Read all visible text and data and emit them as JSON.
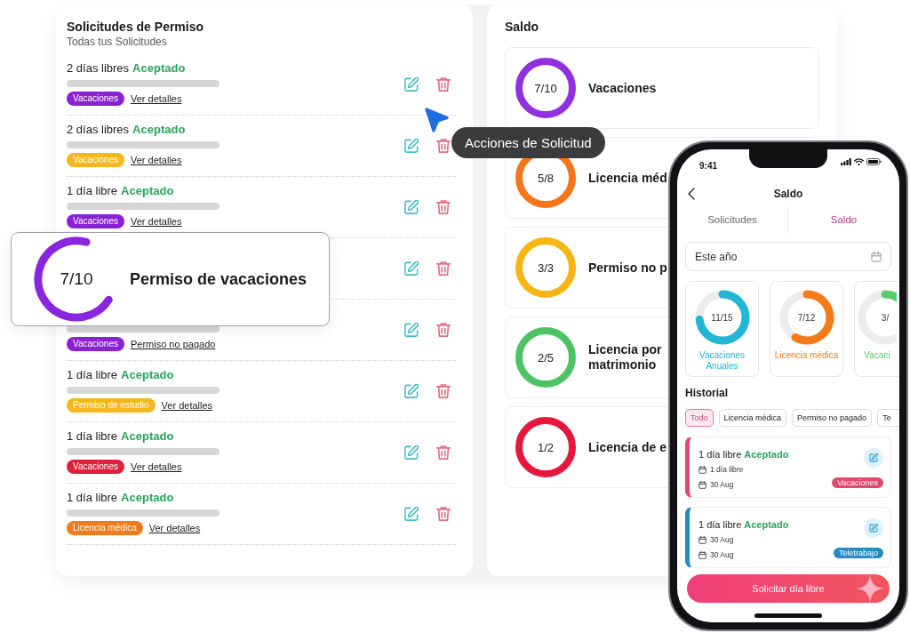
{
  "requests_panel": {
    "title": "Solicitudes de Permiso",
    "subtitle": "Todas tus Solicitudes",
    "rows": [
      {
        "title": "2 días libres",
        "status": "Aceptado",
        "tag": "Vacaciones",
        "color": "#8a22d2",
        "link": "Ver detalles"
      },
      {
        "title": "2 días libres",
        "status": "Aceptado",
        "tag": "Vacaciones",
        "color": "#f4b71c",
        "link": "Ver detalles"
      },
      {
        "title": "1 día libre",
        "status": "Aceptado",
        "tag": "Vacaciones",
        "color": "#8a22d2",
        "link": "Ver detalles"
      },
      {},
      {
        "tag": "Vacaciones",
        "color": "#8a22d2",
        "link": "Permiso no pagado"
      },
      {
        "title": "1 día libre",
        "status": "Aceptado",
        "tag": "Permiso de estudio",
        "color": "#f4b71c",
        "link": "Ver detalles"
      },
      {
        "title": "1 día libre",
        "status": "Aceptado",
        "tag": "Vacaciones",
        "color": "#e01f3d",
        "link": "Ver detalles"
      },
      {
        "title": "1 día libre",
        "status": "Aceptado",
        "tag": "Licencia médica",
        "color": "#f07b1d",
        "link": "Ver detalles"
      }
    ]
  },
  "tooltip": "Acciones de Solicitud",
  "highlight_card": {
    "value": "7/10",
    "label": "Permiso de vacaciones",
    "level": 0.7
  },
  "balance_panel": {
    "title": "Saldo",
    "items": [
      {
        "value": "7/10",
        "label": "Vacaciones",
        "color": "#9030e0"
      },
      {
        "value": "5/8",
        "label": "Licencia méd",
        "color": "#f3761c"
      },
      {
        "value": "3/3",
        "label": "Permiso no p",
        "color": "#f6b512"
      },
      {
        "value": "2/5",
        "label": "Licencia por matrimonio",
        "color": "#4cc466"
      },
      {
        "value": "1/2",
        "label": "Licencia de e",
        "color": "#e5183c"
      }
    ]
  },
  "phone": {
    "status_time": "9:41",
    "title": "Saldo",
    "tabs": [
      {
        "label": "Solicitudes",
        "selected": false
      },
      {
        "label": "Saldo",
        "selected": true
      }
    ],
    "period_field": {
      "value": "Este año"
    },
    "balance_cards": [
      {
        "value": "11/15",
        "label": "Vacaciones Anuales",
        "color": "#22b6d4",
        "level": 0.73
      },
      {
        "value": "7/12",
        "label": "Licencia médica",
        "color": "#f47a1a",
        "level": 0.58
      },
      {
        "value": "3/",
        "label": "Vacaci",
        "color": "#5acd6a",
        "level": 0.13
      }
    ],
    "history_title": "Historial",
    "filters": [
      {
        "label": "Todo",
        "selected": true
      },
      {
        "label": "Licencia médica",
        "selected": false
      },
      {
        "label": "Permiso no pagado",
        "selected": false
      },
      {
        "label": "Te",
        "selected": false
      }
    ],
    "history": [
      {
        "title": "1 día libre",
        "status": "Aceptado",
        "dates": [
          "1 día libre",
          "30 Aug"
        ],
        "tag": "Vacaciones",
        "color": "#e04a6c"
      },
      {
        "title": "1 día libre",
        "status": "Aceptado",
        "dates": [
          "30 Aug",
          "30 Aug"
        ],
        "tag": "Teletrabajo",
        "color": "#2589c2"
      }
    ],
    "action_button": "Solicitar día libre"
  }
}
